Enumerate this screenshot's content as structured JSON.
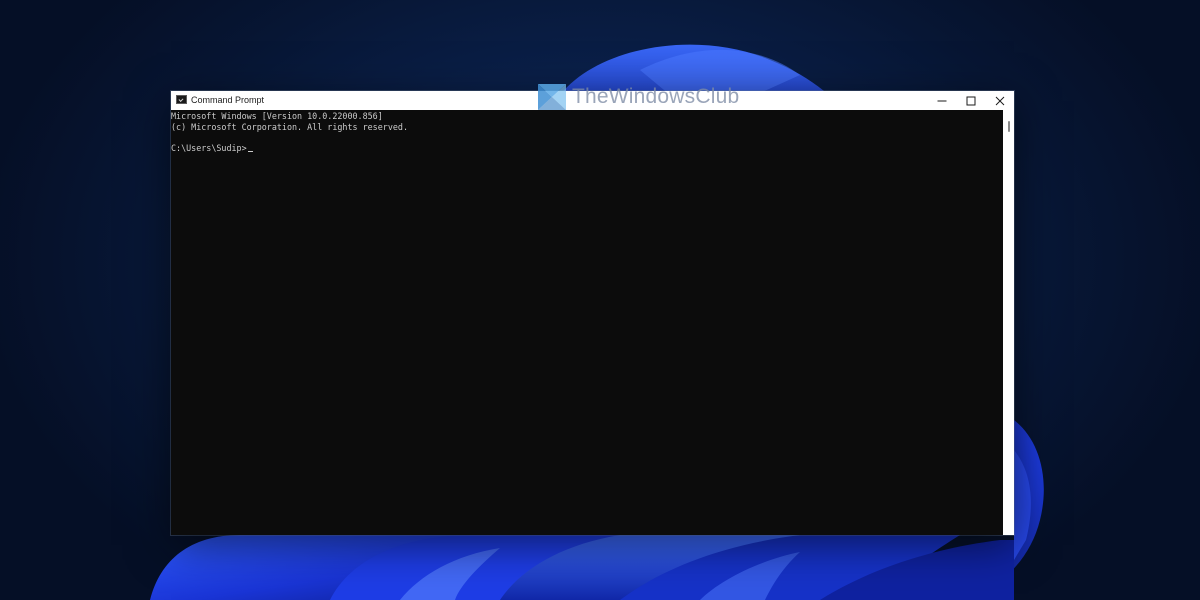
{
  "window": {
    "title": "Command Prompt",
    "controls": {
      "minimize_icon": "minimize-icon",
      "maximize_icon": "maximize-icon",
      "close_icon": "close-icon"
    }
  },
  "console": {
    "lines": [
      "Microsoft Windows [Version 10.0.22000.856]",
      "(c) Microsoft Corporation. All rights reserved.",
      ""
    ],
    "prompt": "C:\\Users\\Sudip>"
  },
  "watermark": {
    "text": "TheWindowsClub"
  },
  "colors": {
    "console_bg": "#0c0c0c",
    "console_text": "#cccccc",
    "titlebar_bg": "#ffffff",
    "desktop_bg": "#0a1f48",
    "bloom_blue": "#1c3de0"
  }
}
